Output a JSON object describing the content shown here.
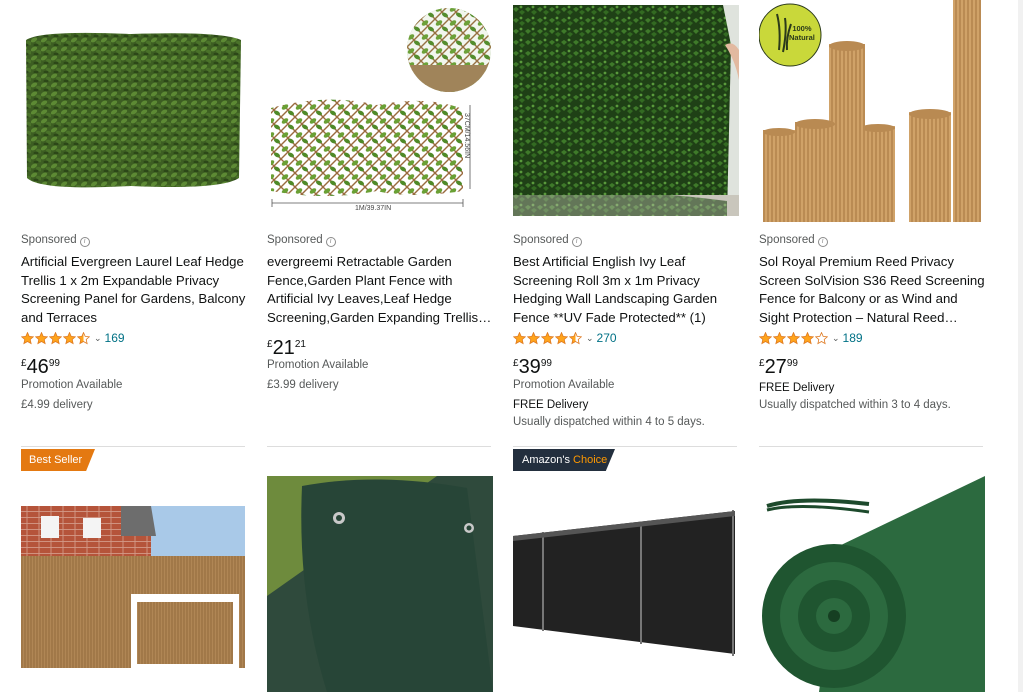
{
  "products": [
    {
      "sponsored": "Sponsored",
      "title": "Artificial Evergreen Laurel Leaf Hedge Trellis 1 x 2m Expandable Privacy Screening Panel for Gardens, Balcony and Terraces",
      "rating_value": 4.5,
      "rating_count": "169",
      "price_symbol": "£",
      "price_whole": "46",
      "price_fraction": "99",
      "lines": [
        "Promotion Available",
        "£4.99 delivery"
      ]
    },
    {
      "sponsored": "Sponsored",
      "title": "evergreemi Retractable Garden Fence,Garden Plant Fence with Artificial Ivy Leaves,Leaf Hedge Screening,Garden Expanding Trellis…",
      "price_symbol": "£",
      "price_whole": "21",
      "price_fraction": "21",
      "lines": [
        "Promotion Available",
        "£3.99 delivery"
      ],
      "image_dim_height": "37CM/14.56IN",
      "image_dim_width": "1M/39.37IN"
    },
    {
      "sponsored": "Sponsored",
      "title": "Best Artificial English Ivy Leaf Screening Roll 3m x 1m Privacy Hedging Wall Landscaping Garden Fence **UV Fade Protected** (1)",
      "rating_value": 4.5,
      "rating_count": "270",
      "price_symbol": "£",
      "price_whole": "39",
      "price_fraction": "99",
      "lines": [
        "Promotion Available",
        "FREE Delivery",
        "Usually dispatched within 4 to 5 days."
      ]
    },
    {
      "sponsored": "Sponsored",
      "title": "Sol Royal Premium Reed Privacy Screen SolVision S36 Reed Screening Fence for Balcony or as Wind and Sight Protection – Natural Reed…",
      "rating_value": 4.0,
      "rating_count": "189",
      "price_symbol": "£",
      "price_whole": "27",
      "price_fraction": "99",
      "lines": [
        "FREE Delivery",
        "Usually dispatched within 3 to 4 days."
      ],
      "image_badge": [
        "100%",
        "Natural"
      ]
    }
  ],
  "badges": {
    "best_seller": "Best Seller",
    "amazons": "Amazon's",
    "choice": "Choice"
  },
  "colors": {
    "star": "#ffa41c",
    "link": "#007185",
    "best_seller": "#e47911",
    "amazons_choice_bg": "#232f3e",
    "amazons_choice_accent": "#ff9900"
  },
  "icons": [
    "star-icon",
    "chevron-down-icon",
    "info-icon"
  ]
}
